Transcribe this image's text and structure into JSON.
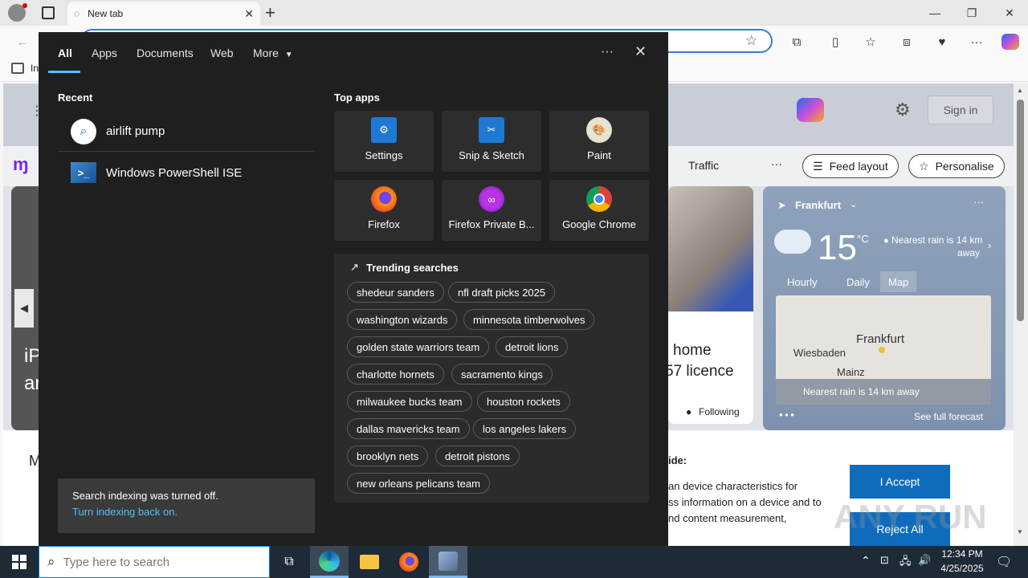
{
  "browser": {
    "tab_title": "New tab",
    "favbar_partial": "In",
    "ntp": {
      "signin_label": "Sign in",
      "nav_traffic": "Traffic",
      "nav_more": "···",
      "feed_layout_label": "Feed layout",
      "personalise_label": "Personalise",
      "left_partial_1": "iP",
      "left_partial_2": "ar",
      "news_partial_1": "home",
      "news_partial_2": "57 licence",
      "following_label": "Following",
      "weather": {
        "city": "Frankfurt",
        "temp": "15",
        "unit": "°C",
        "rain_line1": "Nearest rain is 14 km",
        "rain_line2": "away",
        "tabs": [
          "Hourly",
          "Daily",
          "Map"
        ],
        "map_labels": [
          "Frankfurt",
          "Wiesbaden",
          "Mainz"
        ],
        "map_footer": "Nearest rain is 14 km away",
        "see_full": "See full forecast"
      },
      "cookie": {
        "heading_partial": "ide:",
        "line1": "an device characteristics for",
        "line2": "ss information on a device and to",
        "line3": "nd content measurement,",
        "left_partial": "M",
        "accept_label": "I Accept",
        "reject_label": "Reject All"
      }
    }
  },
  "search_panel": {
    "tabs": [
      "All",
      "Apps",
      "Documents",
      "Web",
      "More"
    ],
    "more_menu_label": "···",
    "recent_title": "Recent",
    "recent_items": [
      "airlift pump",
      "Windows PowerShell ISE"
    ],
    "top_apps_title": "Top apps",
    "top_apps": [
      "Settings",
      "Snip & Sketch",
      "Paint",
      "Firefox",
      "Firefox Private B...",
      "Google Chrome"
    ],
    "trending_title": "Trending searches",
    "trending": [
      "shedeur sanders",
      "nfl draft picks 2025",
      "washington wizards",
      "minnesota timberwolves",
      "golden state warriors team",
      "detroit lions",
      "charlotte hornets",
      "sacramento kings",
      "milwaukee bucks team",
      "houston rockets",
      "dallas mavericks team",
      "los angeles lakers",
      "brooklyn nets",
      "detroit pistons",
      "new orleans pelicans team"
    ],
    "index_note": "Search indexing was turned off.",
    "index_link": "Turn indexing back on."
  },
  "taskbar": {
    "search_placeholder": "Type here to search",
    "time": "12:34 PM",
    "date": "4/25/2025"
  },
  "watermark": "ANY RUN",
  "colors": {
    "accent": "#0078d4",
    "panel_bg": "#1f1f1f",
    "tile_bg": "#2d2d2d",
    "taskbar_bg": "#1f2a37"
  }
}
